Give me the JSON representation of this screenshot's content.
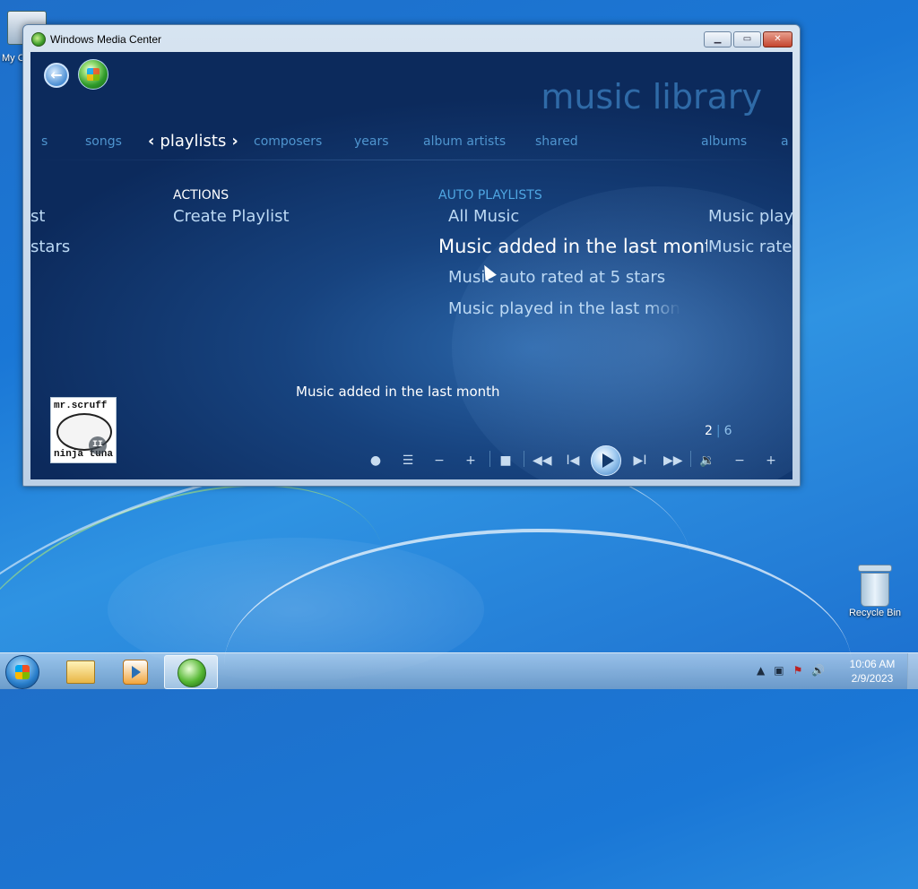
{
  "desktop": {
    "icons": [
      {
        "label": "My C"
      },
      {
        "label": "Recycle Bin"
      }
    ]
  },
  "window": {
    "title": "Windows Media Center",
    "buttons": {
      "minimize": "▁",
      "maximize": "▭",
      "close": "✕"
    }
  },
  "wmc": {
    "page_title": "music library",
    "nav": {
      "items": [
        "s",
        "songs",
        "playlists",
        "composers",
        "years",
        "album artists",
        "shared",
        "albums",
        "a"
      ],
      "active": "playlists",
      "arrow_left": "‹",
      "arrow_right": "›"
    },
    "columns": {
      "left_partial": [
        "st",
        "stars"
      ],
      "actions": {
        "header": "ACTIONS",
        "items": [
          "Create Playlist"
        ]
      },
      "auto_playlists": {
        "header": "AUTO PLAYLISTS",
        "items": [
          "All Music",
          "Music added in the last mont",
          "Music auto rated at 5 stars",
          "Music played in the last mon"
        ],
        "focused_index": 1
      },
      "right_partial": [
        "Music play",
        "Music rate"
      ]
    },
    "tooltip": "Music added in the last month",
    "now_playing": {
      "album_line1": "mr.scruff",
      "album_line2": "ninja tuna",
      "state": "paused"
    },
    "pager": {
      "current": "2",
      "total": "6"
    },
    "transport": [
      "record",
      "menu",
      "zoom-out",
      "zoom-in",
      "stop",
      "rewind",
      "previous",
      "play",
      "next",
      "fast-forward",
      "volume",
      "volume-down",
      "volume-up"
    ]
  },
  "taskbar": {
    "clock_time": "10:06 AM",
    "clock_date": "2/9/2023",
    "tray_up": "▲"
  },
  "colors": {
    "accent": "#4f95cf",
    "nav_inactive": "#4f95cf",
    "title_blue": "#2f6aa7"
  }
}
